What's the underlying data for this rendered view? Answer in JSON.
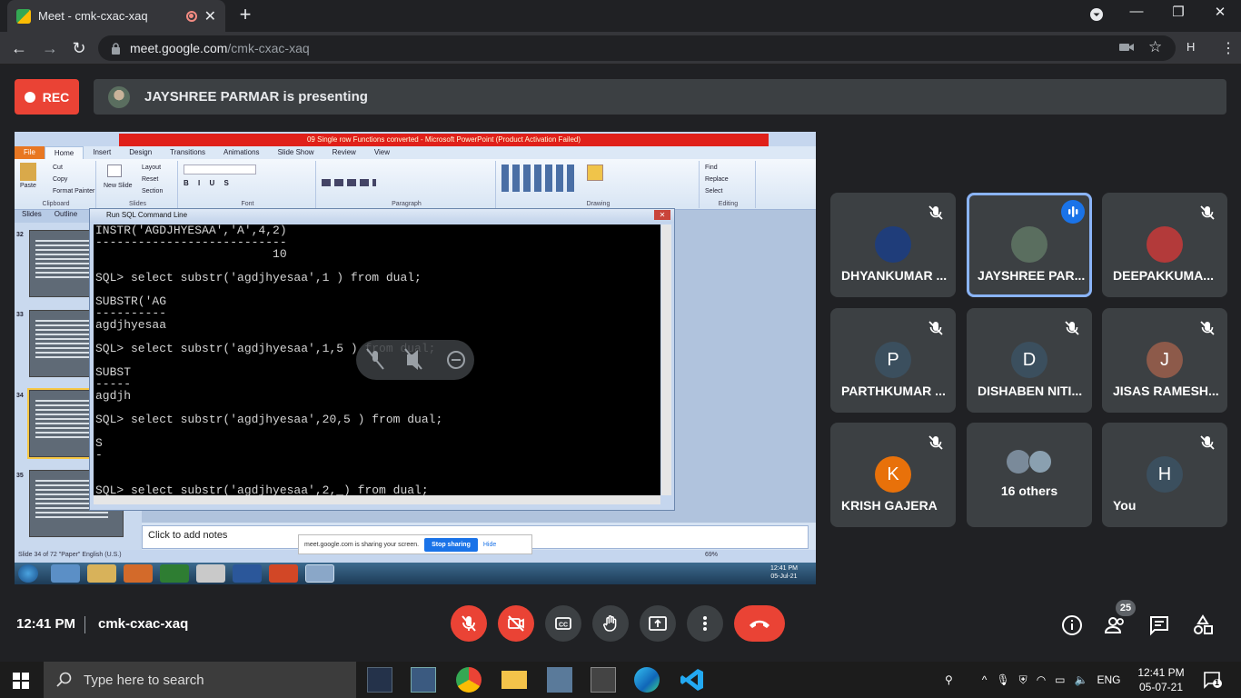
{
  "browser": {
    "tab_title": "Meet - cmk-cxac-xaq",
    "url_domain": "meet.google.com",
    "url_path": "/cmk-cxac-xaq",
    "profile_initial": "H"
  },
  "meet": {
    "rec_label": "REC",
    "presenting_text": "JAYSHREE PARMAR is presenting",
    "time": "12:41 PM",
    "meeting_code": "cmk-cxac-xaq",
    "participants_count": "25",
    "participants": [
      {
        "name": "DHYANKUMAR ...",
        "initial": "",
        "color": "#1f3d7a",
        "muted": true,
        "speaking": false
      },
      {
        "name": "JAYSHREE PAR...",
        "initial": "",
        "color": "#5a6e5f",
        "muted": false,
        "speaking": true
      },
      {
        "name": "DEEPAKKUMA...",
        "initial": "",
        "color": "#b33a3a",
        "muted": true,
        "speaking": false
      },
      {
        "name": "PARTHKUMAR ...",
        "initial": "P",
        "color": "#3b4f5e",
        "muted": true,
        "speaking": false
      },
      {
        "name": "DISHABEN NITI...",
        "initial": "D",
        "color": "#3b4f5e",
        "muted": true,
        "speaking": false
      },
      {
        "name": "JISAS RAMESH...",
        "initial": "J",
        "color": "#8d5a4a",
        "muted": true,
        "speaking": false
      },
      {
        "name": "KRISH GAJERA",
        "initial": "K",
        "color": "#e8710a",
        "muted": true,
        "speaking": false
      },
      {
        "name": "16 others",
        "initial": "",
        "color": "#3c4043",
        "muted": false,
        "speaking": false
      },
      {
        "name": "You",
        "initial": "H",
        "color": "#3b4f5e",
        "muted": true,
        "speaking": false
      }
    ]
  },
  "presentation": {
    "title_bar": "09 Single row Functions converted - Microsoft PowerPoint (Product Activation Failed)",
    "ribbon_tabs": [
      "File",
      "Home",
      "Insert",
      "Design",
      "Transitions",
      "Animations",
      "Slide Show",
      "Review",
      "View"
    ],
    "ribbon_groups": [
      "Clipboard",
      "Slides",
      "Font",
      "Paragraph",
      "Drawing",
      "Editing"
    ],
    "clipboard_items": [
      "Paste",
      "Cut",
      "Copy",
      "Format Painter"
    ],
    "slides_items": [
      "New Slide",
      "Layout",
      "Reset",
      "Section"
    ],
    "editing_items": [
      "Find",
      "Replace",
      "Select"
    ],
    "panel_tabs": [
      "Slides",
      "Outline"
    ],
    "slide_numbers": [
      "32",
      "33",
      "34",
      "35"
    ],
    "notes_placeholder": "Click to add notes",
    "status_text": "Slide 34 of 72   \"Paper\"   English (U.S.)",
    "zoom": "69%",
    "tray_time": "12:41 PM",
    "tray_date": "05-Jul-21",
    "share_text": "meet.google.com is sharing your screen.",
    "stop_sharing": "Stop sharing",
    "hide": "Hide"
  },
  "sql_window": {
    "title": "Run SQL Command Line",
    "lines": [
      "INSTR('AGDJHYESAA','A',4,2)",
      "---------------------------",
      "                         10",
      "",
      "SQL> select substr('agdjhyesaa',1 ) from dual;",
      "",
      "SUBSTR('AG",
      "----------",
      "agdjhyesaa",
      "",
      "SQL> select substr('agdjhyesaa',1,5 ) from dual;",
      "",
      "SUBST",
      "-----",
      "agdjh",
      "",
      "SQL> select substr('agdjhyesaa',20,5 ) from dual;",
      "",
      "S",
      "-",
      "",
      "",
      "SQL> select substr('agdjhyesaa',2,_) from dual;"
    ]
  },
  "windows": {
    "search_placeholder": "Type here to search",
    "lang": "ENG",
    "time": "12:41 PM",
    "date": "05-07-21",
    "notifications": "1"
  }
}
